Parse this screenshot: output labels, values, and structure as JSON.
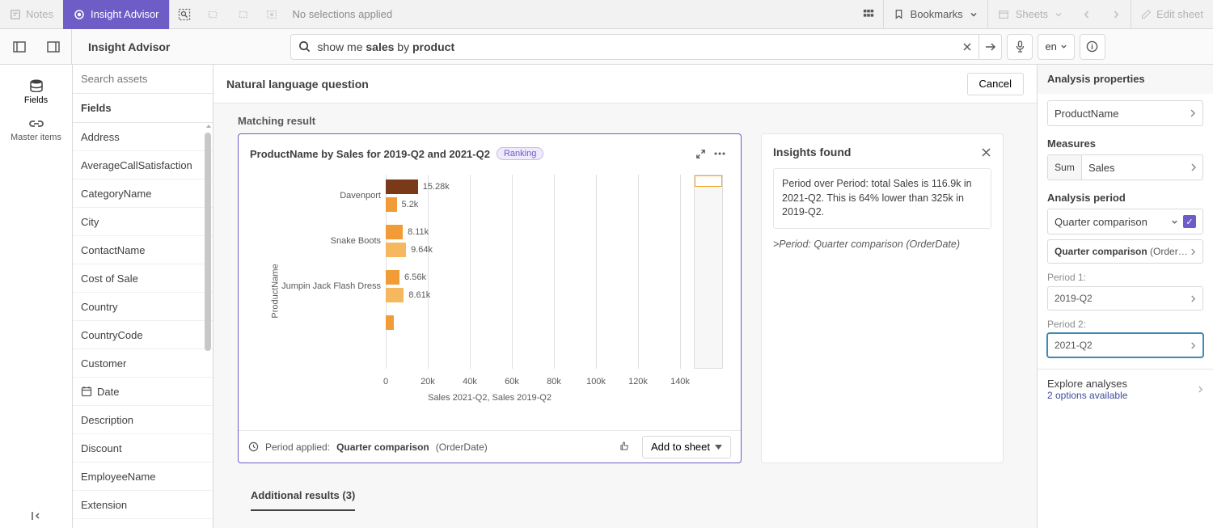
{
  "toolbar": {
    "notes": "Notes",
    "insight_advisor": "Insight Advisor",
    "no_selections": "No selections applied",
    "bookmarks": "Bookmarks",
    "sheets": "Sheets",
    "edit_sheet": "Edit sheet"
  },
  "second_bar": {
    "title": "Insight Advisor",
    "search_display_pre": "show me ",
    "search_display_b1": "sales",
    "search_display_mid": " by ",
    "search_display_b2": "product",
    "lang": "en"
  },
  "rail": {
    "fields": "Fields",
    "master": "Master items"
  },
  "assets": {
    "search_placeholder": "Search assets",
    "header": "Fields",
    "items": [
      {
        "label": "Address"
      },
      {
        "label": "AverageCallSatisfaction"
      },
      {
        "label": "CategoryName"
      },
      {
        "label": "City"
      },
      {
        "label": "ContactName"
      },
      {
        "label": "Cost of Sale"
      },
      {
        "label": "Country"
      },
      {
        "label": "CountryCode"
      },
      {
        "label": "Customer"
      },
      {
        "label": "Date",
        "icon": "date"
      },
      {
        "label": "Description"
      },
      {
        "label": "Discount"
      },
      {
        "label": "EmployeeName"
      },
      {
        "label": "Extension"
      }
    ]
  },
  "center": {
    "nlq_title": "Natural language question",
    "cancel": "Cancel",
    "matching": "Matching result",
    "chart": {
      "title": "ProductName by Sales for 2019-Q2 and 2021-Q2",
      "badge": "Ranking",
      "period_applied_label": "Period applied:",
      "period_applied_value": "Quarter comparison",
      "period_applied_suffix": "(OrderDate)",
      "add_to_sheet": "Add to sheet"
    },
    "insights": {
      "title": "Insights found",
      "text": "Period over Period: total Sales is 116.9k in 2021-Q2. This is 64% lower than 325k in 2019-Q2.",
      "link": ">Period: Quarter comparison (OrderDate)"
    },
    "additional": "Additional results (3)"
  },
  "props": {
    "title": "Analysis properties",
    "dim": "ProductName",
    "measures_label": "Measures",
    "measure_agg": "Sum",
    "measure_name": "Sales",
    "period_label": "Analysis period",
    "period_type": "Quarter comparison",
    "period_sub": "Quarter comparison (OrderD...",
    "p1_label": "Period 1:",
    "p1_value": "2019-Q2",
    "p2_label": "Period 2:",
    "p2_value": "2021-Q2",
    "explore_title": "Explore analyses",
    "explore_sub": "2 options available"
  },
  "chart_data": {
    "type": "bar",
    "orientation": "horizontal",
    "title": "ProductName by Sales for 2019-Q2 and 2021-Q2",
    "ylabel": "ProductName",
    "xlabel": "Sales 2021-Q2, Sales 2019-Q2",
    "xlim": [
      0,
      150000
    ],
    "xticks": [
      0,
      20000,
      40000,
      60000,
      80000,
      100000,
      120000,
      140000
    ],
    "xtick_labels": [
      "0",
      "20k",
      "40k",
      "60k",
      "80k",
      "100k",
      "120k",
      "140k"
    ],
    "categories": [
      "Davenport",
      "Snake Boots",
      "Jumpin Jack Flash Dress",
      ""
    ],
    "series": [
      {
        "name": "Sales 2021-Q2",
        "values": [
          15280,
          8110,
          6560,
          4000
        ],
        "labels": [
          "15.28k",
          "8.11k",
          "6.56k",
          ""
        ],
        "color": "#a0522d"
      },
      {
        "name": "Sales 2019-Q2",
        "values": [
          5200,
          9640,
          8610,
          null
        ],
        "labels": [
          "5.2k",
          "9.64k",
          "8.61k",
          ""
        ],
        "color": "#f2a33c"
      }
    ],
    "colors": {
      "s1_0": "#7a3a1a",
      "s1_rest": "#f29c38",
      "s2_0": "#f29c38",
      "s2_rest": "#f5b85e"
    }
  }
}
